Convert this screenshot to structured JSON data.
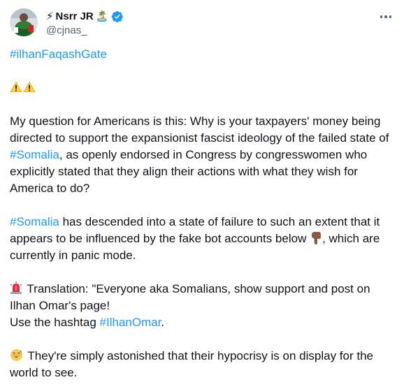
{
  "author": {
    "name_prefix_emoji": "⚡",
    "name": "Nsrr JR",
    "name_suffix_emoji": "🏝️",
    "handle": "@cjnas_",
    "verified": true,
    "verified_color": "#1d9bf0"
  },
  "tweet": {
    "hashtag_top": "#ilhanFaqashGate",
    "p1_text_a": "My question for Americans is this: Why is your taxpayers' money being directed to support the expansionist fascist ideology of the failed state of ",
    "p1_link": "#Somalia",
    "p1_text_b": ", as openly endorsed in Congress by congresswomen who explicitly stated that they align their actions with what they wish for America to do?",
    "p2_link": "#Somalia",
    "p2_text_a": " has descended into a state of failure to such an extent that it appears to be influenced by the fake bot accounts below ",
    "p2_text_b": ", which are currently in panic mode.",
    "p3_text_a": " Translation: \"Everyone aka Somalians, show support and post on Ilhan Omar's page!",
    "p3_text_b": "Use the hashtag ",
    "p3_link": "#IlhanOmar",
    "p3_text_c": ".",
    "p4_text": " They're simply astonished that their hypocrisy is on display for the world to see."
  },
  "icons": {
    "warning": "warning-icon",
    "siren": "siren-icon",
    "pointing_down": "backhand-index-pointing-down-icon",
    "sweat_smile": "grinning-face-with-sweat-icon",
    "more": "more-options-icon"
  },
  "colors": {
    "link": "#1d9bf0",
    "text": "#0f1419",
    "secondary": "#536471"
  }
}
